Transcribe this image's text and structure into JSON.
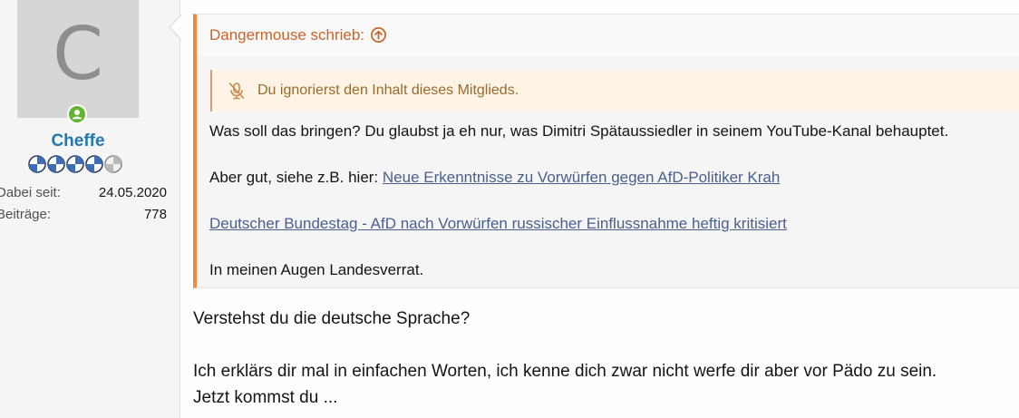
{
  "user": {
    "avatar_letter": "C",
    "name": "Cheffe",
    "online_status": "online",
    "rank_stars": 4,
    "rank_max": 5,
    "stats": [
      {
        "label": "Dabei seit:",
        "value": "24.05.2020"
      },
      {
        "label": "Beiträge:",
        "value": "778"
      }
    ]
  },
  "quote": {
    "author_line": "Dangermouse schrieb:",
    "jump_icon": "arrow-up-circle-icon",
    "ignored_icon": "muted-microphone-icon",
    "ignored_notice": "Du ignorierst den Inhalt dieses Mitglieds.",
    "line1": "Was soll das bringen? Du glaubst ja eh nur, was Dimitri Spätaussiedler in seinem YouTube-Kanal behauptet.",
    "line2_prefix": "Aber gut, siehe z.B. hier: ",
    "link1": "Neue Erkenntnisse zu Vorwürfen gegen AfD-Politiker Krah",
    "link2": "Deutscher Bundestag - AfD nach Vorwürfen russischer Einflussnahme heftig kritisiert",
    "line4": "In meinen Augen Landesverrat."
  },
  "reply": {
    "line1": "Verstehst du die deutsche Sprache?",
    "line2": "Ich erklärs dir mal in einfachen Worten, ich kenne dich zwar nicht werfe dir aber vor Pädo zu sein.",
    "line3": "Jetzt kommst du ..."
  },
  "colors": {
    "accent_orange": "#f7883a",
    "username_blue": "#2577b1",
    "link_blue": "#4a5f8e",
    "online_green": "#63b531"
  }
}
